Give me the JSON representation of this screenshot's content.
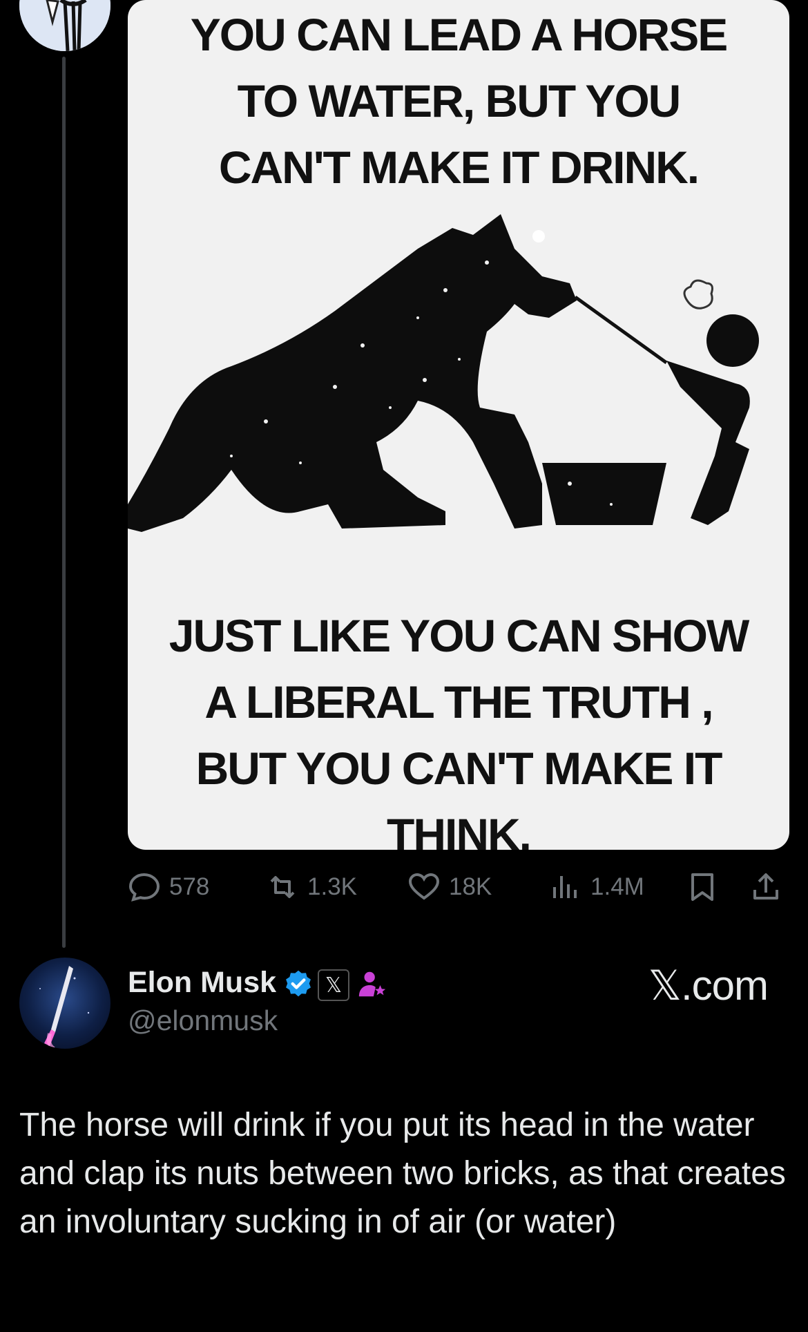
{
  "meme": {
    "top_lines": [
      "YOU CAN LEAD A HORSE",
      "TO WATER, BUT YOU",
      "CAN'T MAKE IT DRINK."
    ],
    "bottom_lines": [
      "JUST LIKE YOU CAN SHOW",
      "A LIBERAL THE TRUTH ,",
      "BUT YOU CAN'T MAKE IT",
      "THINK."
    ]
  },
  "actions": {
    "replies": "578",
    "reposts": "1.3K",
    "likes": "18K",
    "views": "1.4M",
    "icons": [
      "reply-icon",
      "repost-icon",
      "like-icon",
      "views-icon",
      "bookmark-icon",
      "share-icon"
    ]
  },
  "author": {
    "name": "Elon Musk",
    "handle": "@elonmusk",
    "badge_x": "𝕏",
    "verified_color": "#1d9bf0",
    "affiliate_color": "#c941d6"
  },
  "brand": {
    "label": "𝕏.com"
  },
  "post": {
    "text": "The horse will drink if you put its head in the water and clap its nuts between two bricks, as that creates an involuntary sucking in of air (or water)"
  }
}
